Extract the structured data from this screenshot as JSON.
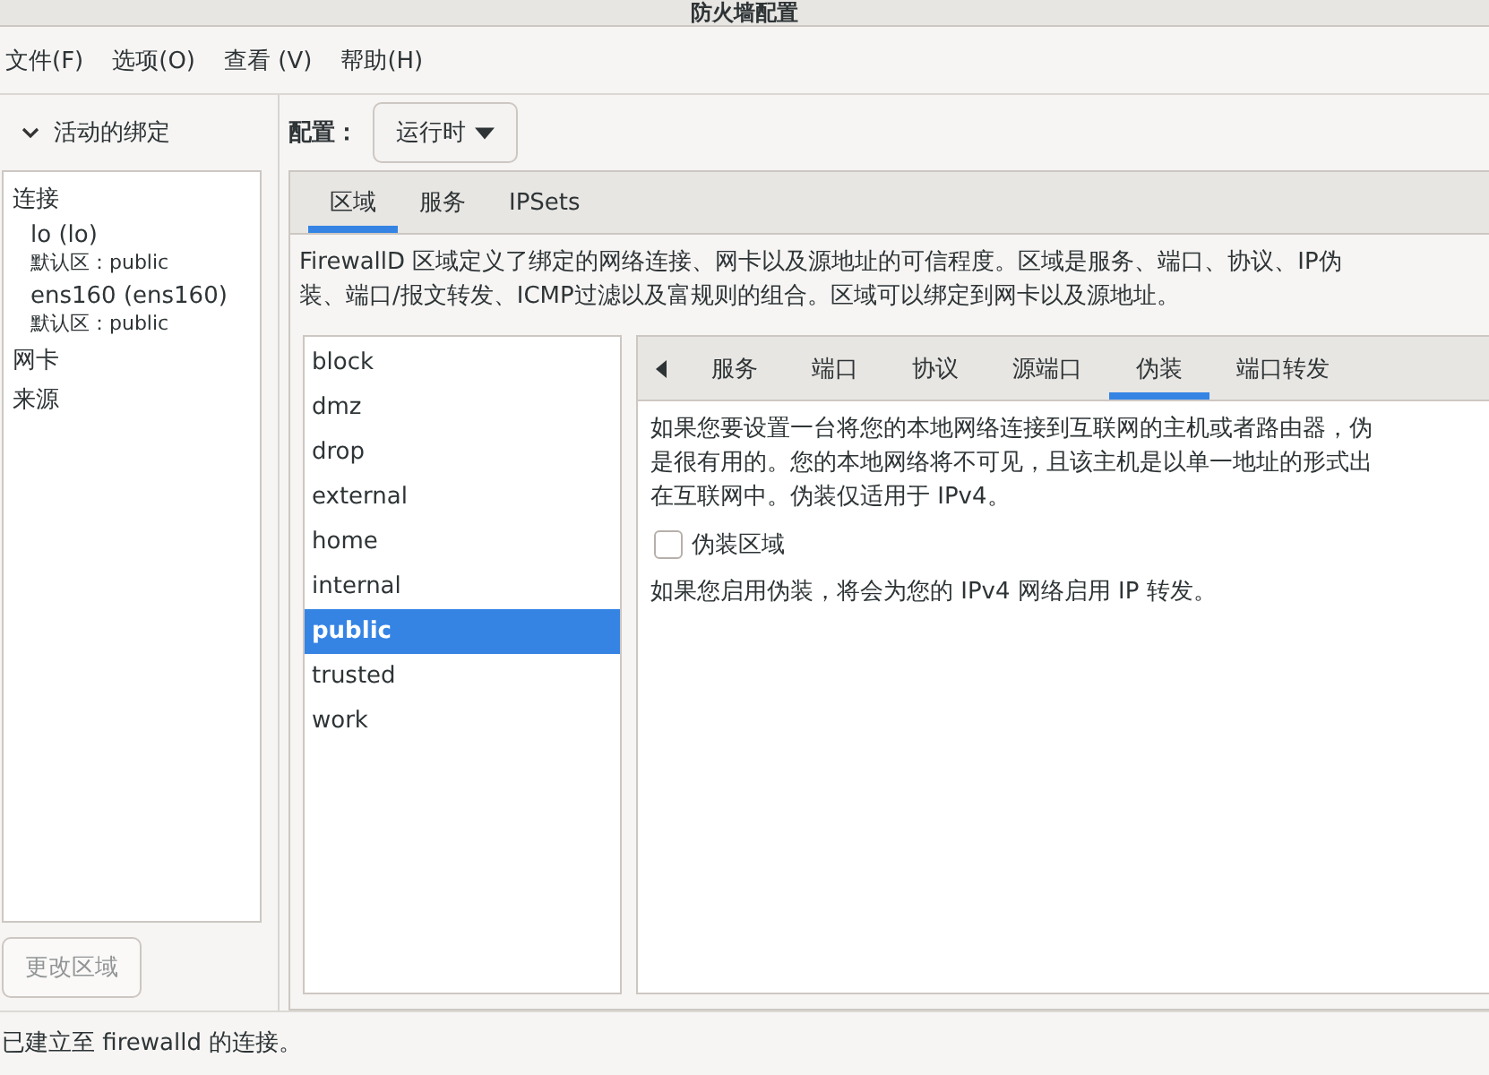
{
  "window": {
    "title": "防火墙配置"
  },
  "menu": [
    "文件(F)",
    "选项(O)",
    "查看 (V)",
    "帮助(H)"
  ],
  "bindings": {
    "header": "活动的绑定",
    "expanded": true,
    "groups": [
      {
        "label": "连接",
        "items": [
          {
            "name": "lo (lo)",
            "zone": "默认区：public"
          },
          {
            "name": "ens160 (ens160)",
            "zone": "默认区：public"
          }
        ]
      },
      {
        "label": "网卡"
      },
      {
        "label": "来源"
      }
    ],
    "button": {
      "label": "更改区域",
      "disabled": true
    }
  },
  "config": {
    "label": "配置：",
    "value": "运行时"
  },
  "tabs": [
    {
      "label": "区域",
      "selected": true
    },
    {
      "label": "服务",
      "selected": false
    },
    {
      "label": "IPSets",
      "selected": false
    }
  ],
  "description": [
    "FirewallD 区域定义了绑定的网络连接、网卡以及源地址的可信程度。区域是服务、端口、协议、IP伪",
    "装、端口/报文转发、ICMP过滤以及富规则的组合。区域可以绑定到网卡以及源地址。"
  ],
  "zones": [
    {
      "name": "block",
      "selected": false
    },
    {
      "name": "dmz",
      "selected": false
    },
    {
      "name": "drop",
      "selected": false
    },
    {
      "name": "external",
      "selected": false
    },
    {
      "name": "home",
      "selected": false
    },
    {
      "name": "internal",
      "selected": false
    },
    {
      "name": "public",
      "selected": true
    },
    {
      "name": "trusted",
      "selected": false
    },
    {
      "name": "work",
      "selected": false
    }
  ],
  "zone_tabs": [
    {
      "label": "服务",
      "selected": false
    },
    {
      "label": "端口",
      "selected": false
    },
    {
      "label": "协议",
      "selected": false
    },
    {
      "label": "源端口",
      "selected": false
    },
    {
      "label": "伪装",
      "selected": true
    },
    {
      "label": "端口转发",
      "selected": false
    }
  ],
  "masquerade": {
    "info": [
      "如果您要设置一台将您的本地网络连接到互联网的主机或者路由器，伪",
      "是很有用的。您的本地网络将不可见，且该主机是以单一地址的形式出",
      "在互联网中。伪装仅适用于 IPv4。"
    ],
    "checkbox": {
      "label": "伪装区域",
      "checked": false
    },
    "note": "如果您启用伪装，将会为您的 IPv4 网络启用 IP 转发。"
  },
  "status_bar": "已建立至 firewalld 的连接。"
}
